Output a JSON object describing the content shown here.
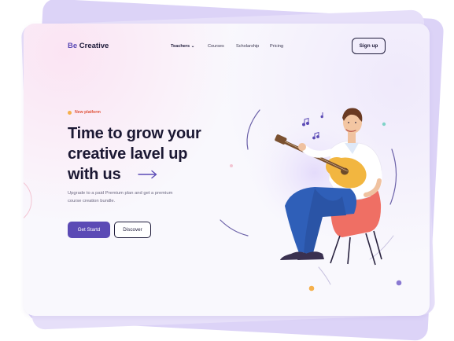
{
  "brand": {
    "prefix": "Be",
    "name": "Creative"
  },
  "nav": {
    "items": [
      {
        "label": "Teachers",
        "has_dropdown": true,
        "active": true
      },
      {
        "label": "Courses"
      },
      {
        "label": "Scholarship"
      },
      {
        "label": "Pricing"
      }
    ],
    "dropdown_glyph": "⌄"
  },
  "header": {
    "signup_label": "Sign up"
  },
  "hero": {
    "badge": "New platform",
    "headline_lines": [
      "Time to grow your",
      "creative lavel up",
      "with us"
    ],
    "subtext_lines": [
      "Upgrade to a paid Premium plan and get a premium",
      "course creation bundle."
    ],
    "primary_label": "Get Startd",
    "secondary_label": "Discover"
  },
  "colors": {
    "accent": "#5b4ab5",
    "text": "#1e1b3a",
    "badge_text": "#e0543c",
    "badge_dot": "#f5b04c",
    "chair": "#ef6f64",
    "shirt": "#ffffff",
    "pants": "#2f5fb8",
    "guitar": "#f2b640"
  },
  "icons": [
    "arrow-right-icon",
    "music-note-icon",
    "chevron-down-icon"
  ]
}
